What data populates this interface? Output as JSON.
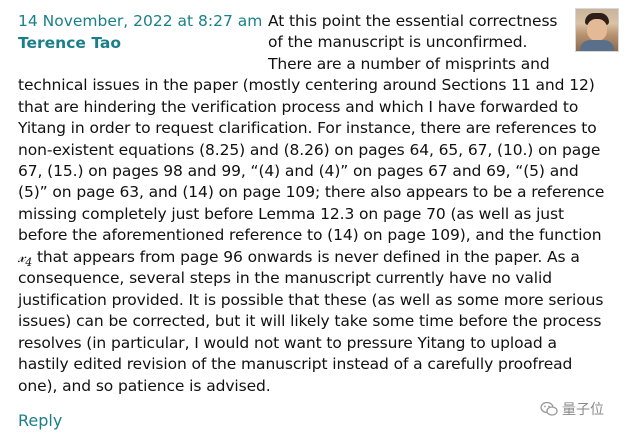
{
  "comment": {
    "date": "14 November, 2022 at 8:27 am",
    "author": "Terence Tao",
    "lines": [
      "At this point the essential correctness",
      "of the manuscript is unconfirmed.",
      "There are a number of misprints and",
      "technical issues in the paper (mostly centering around Sections 11 and 12)",
      "that are hindering the verification process and which I have forwarded to",
      "Yitang in order to request clarification. For instance, there are references to",
      "non-existent equations (8.25) and (8.26) on pages 64, 65, 67, (10.) on page",
      "67, (15.) on pages 98 and 99, “(4) and (4)” on pages 67 and 69, “(5) and",
      "(5)” on page 63, and (14) on page 109; there also appears to be a reference",
      "missing completely just before Lemma 12.3 on page 70 (as well as just",
      "before the aforementioned reference to (14) on page 109), and the function",
      "that appears from page 96 onwards is never defined in the paper. As a",
      "consequence, several steps in the manuscript currently have no valid",
      "justification provided. It is possible that these (as well as some more serious",
      "issues) can be corrected, but it will likely take some time before the process",
      "resolves (in particular, I would not want to pressure Yitang to upload a",
      "hastily edited revision of the manuscript instead of a carefully proofread",
      "one), and so patience is advised."
    ],
    "function_symbol": "𝓍",
    "function_subscript": "4",
    "reply_label": "Reply"
  },
  "watermark": {
    "text": "量子位",
    "icon": "wechat-icon"
  },
  "colors": {
    "link": "#1a7f8a",
    "text": "#111111",
    "watermark": "#8a8a8a"
  }
}
